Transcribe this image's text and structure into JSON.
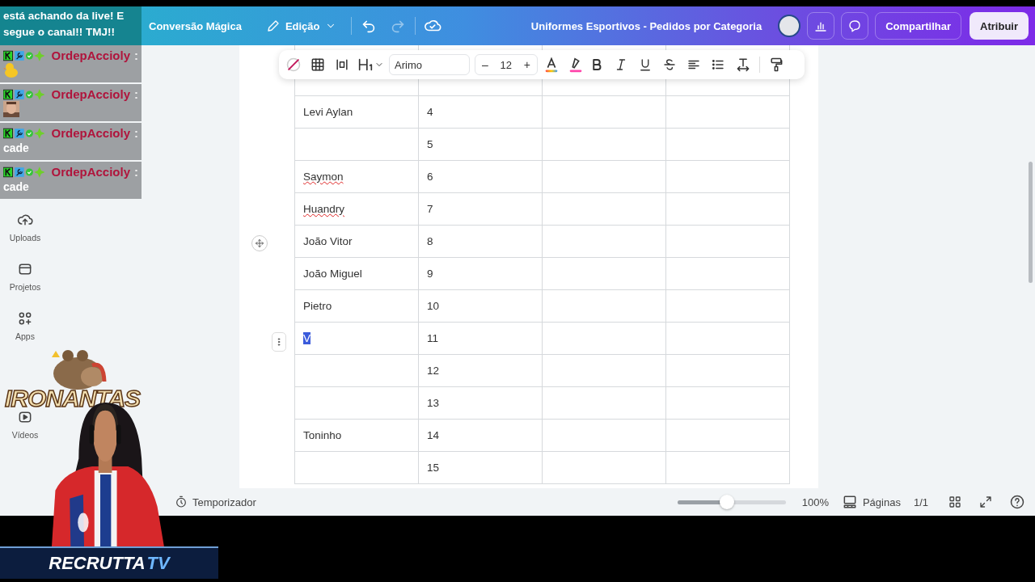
{
  "header": {
    "menu": [
      {
        "label": "Conversão Mágica"
      }
    ],
    "edit": "Edição",
    "redo_disabled": true,
    "title": "Uniformes Esportivos - Pedidos por Categoria",
    "share": "Compartilhar",
    "assign": "Atribuir"
  },
  "sidebar": {
    "items": [
      {
        "label": "Uploads"
      },
      {
        "label": "Projetos"
      },
      {
        "label": "Apps"
      },
      {
        "label": "Vídeos"
      }
    ]
  },
  "toolbar": {
    "font": "Arimo",
    "size": "12",
    "minus": "–",
    "plus": "+"
  },
  "table": {
    "rows": [
      {
        "name": "Levi Aylan",
        "number": "4",
        "spell_flag": false,
        "text_selected": false
      },
      {
        "number": "5"
      },
      {
        "name": "Saymon",
        "number": "6",
        "spell_flag": true,
        "text_selected": false
      },
      {
        "name": "Huandry",
        "number": "7",
        "spell_flag": true,
        "text_selected": false
      },
      {
        "name": "João Vitor",
        "number": "8",
        "spell_flag": false,
        "text_selected": false
      },
      {
        "name": "João Miguel",
        "number": "9",
        "spell_flag": false,
        "text_selected": false
      },
      {
        "name": "Pietro",
        "number": "10",
        "spell_flag": false,
        "text_selected": false
      },
      {
        "name": "V",
        "number": "11",
        "spell_flag": false,
        "text_selected": true
      },
      {
        "number": "12"
      },
      {
        "number": "13"
      },
      {
        "name": "Toninho",
        "number": "14",
        "spell_flag": false,
        "text_selected": false
      },
      {
        "number": "15"
      }
    ]
  },
  "bottom_bar": {
    "timer": "Temporizador",
    "zoom": {
      "level": 0.46,
      "reading": "100%"
    },
    "pages": "Páginas",
    "page_count": "1/1"
  },
  "overlay": {
    "banner": "está achando da live! E segue o canal!! TMJ!!",
    "chat": [
      {
        "user": "OrdepAccioly",
        "separator": ":",
        "kind": "duck"
      },
      {
        "user": "OrdepAccioly",
        "separator": ":"
      },
      {
        "user": "OrdepAccioly",
        "separator": ":",
        "kind": "text",
        "text": "cade"
      },
      {
        "user": "OrdepAccioly",
        "separator": ":",
        "kind": "text",
        "text": "cade"
      }
    ],
    "logo": "IRONANTAS",
    "stream_logo": {
      "text": "RECRUTTA",
      "accent": "TV"
    }
  }
}
